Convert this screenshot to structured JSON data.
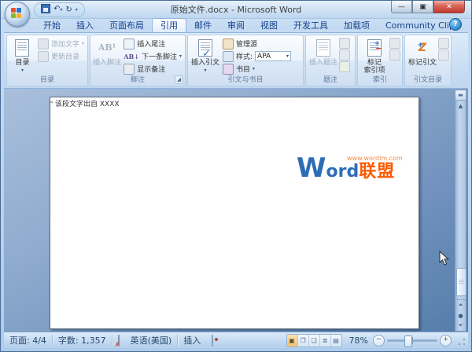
{
  "titlebar": {
    "title": "原始文件.docx - Microsoft Word"
  },
  "tabs": [
    {
      "label": "开始"
    },
    {
      "label": "插入"
    },
    {
      "label": "页面布局"
    },
    {
      "label": "引用"
    },
    {
      "label": "邮件"
    },
    {
      "label": "审阅"
    },
    {
      "label": "视图"
    },
    {
      "label": "开发工具"
    },
    {
      "label": "加载项"
    },
    {
      "label": "Community Clips"
    }
  ],
  "help": {
    "glyph": "?"
  },
  "ribbon": {
    "toc": {
      "group_label": "目录",
      "toc_button": "目录",
      "add_text": "添加文字",
      "update_toc": "更新目录"
    },
    "footnotes": {
      "group_label": "脚注",
      "insert_footnote": "插入脚注",
      "insert_endnote": "插入尾注",
      "next_footnote": "下一条脚注",
      "show_notes": "显示备注"
    },
    "citations": {
      "group_label": "引文与书目",
      "insert_citation": "插入引文",
      "manage_sources": "管理源",
      "style_label": "样式:",
      "style_value": "APA",
      "bibliography": "书目"
    },
    "captions": {
      "group_label": "题注",
      "insert_caption": "插入题注"
    },
    "index": {
      "group_label": "索引",
      "mark_entry_line1": "标记",
      "mark_entry_line2": "索引项"
    },
    "toa": {
      "group_label": "引文目录",
      "mark_citation": "标记引文"
    }
  },
  "document": {
    "ref_mark": "=",
    "paragraph": "该段文字出自 XXXX"
  },
  "watermark": {
    "url": "www.wordlm.com",
    "w": "W",
    "ord": "ord",
    "cn": "联盟"
  },
  "statusbar": {
    "page": "页面: 4/4",
    "words": "字数: 1,357",
    "language": "英语(美国)",
    "insert_mode": "插入",
    "zoom_level": "78%"
  },
  "colors": {
    "tab_text": "#15428b",
    "watermark_blue": "#2e6db5",
    "watermark_orange": "#ff5a00",
    "close_button_red": "#c0392e",
    "doc_bg_dark": "#557daa"
  }
}
